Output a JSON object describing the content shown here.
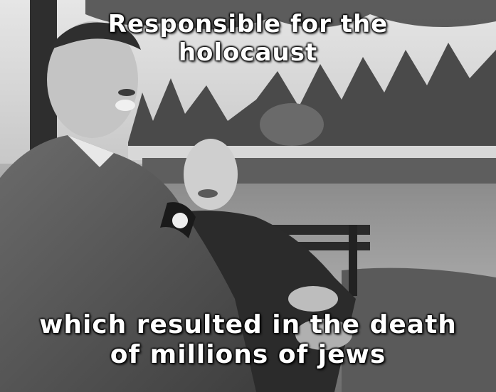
{
  "image": {
    "description_icon": "photo-icon"
  },
  "captions": {
    "top": {
      "line1": "Responsible for the",
      "line2": "holocaust"
    },
    "bottom": {
      "line1": "which resulted in the death",
      "line2": "of millions of jews"
    }
  },
  "colors": {
    "caption_text": "#ffffff",
    "caption_outline": "#000000"
  }
}
